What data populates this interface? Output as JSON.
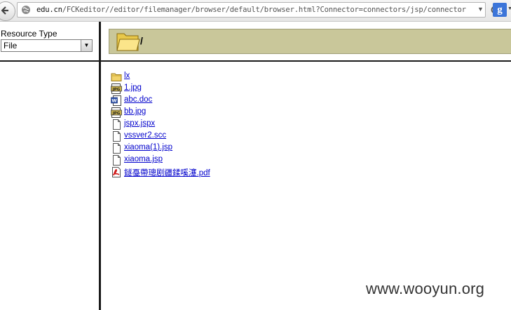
{
  "browser": {
    "url_host": "edu.cn",
    "url_path": "/FCKeditor//editor/filemanager/browser/default/browser.html?Connector=connectors/jsp/connector",
    "search_engine_label": "g"
  },
  "left": {
    "resource_label": "Resource Type",
    "resource_value": "File"
  },
  "right": {
    "current_path": "/"
  },
  "files": [
    {
      "name": "lx",
      "icon": "folder-icon"
    },
    {
      "name": "1.jpg",
      "icon": "jpg-file-icon"
    },
    {
      "name": "abc.doc",
      "icon": "word-file-icon"
    },
    {
      "name": "bb.jpg",
      "icon": "jpg-file-icon"
    },
    {
      "name": "jspx.jspx",
      "icon": "generic-file-icon"
    },
    {
      "name": "vssver2.scc",
      "icon": "generic-file-icon"
    },
    {
      "name": "xiaoma(1).jsp",
      "icon": "generic-file-icon"
    },
    {
      "name": "xiaoma.jsp",
      "icon": "generic-file-icon"
    },
    {
      "name": "鐩戞帶璁剧疆鍒嗘瀽.pdf",
      "icon": "pdf-file-icon"
    }
  ],
  "watermark": "www.wooyun.org",
  "colors": {
    "banner": "#c9c79a",
    "link": "#0000cc",
    "frame_border": "#1a1a1a"
  }
}
